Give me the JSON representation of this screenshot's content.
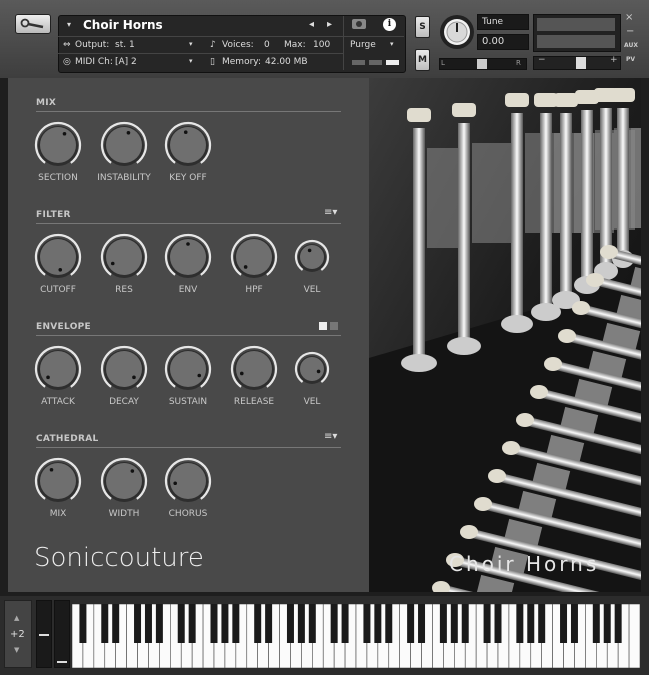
{
  "header": {
    "instrument_name": "Choir Horns",
    "output_label": "Output:",
    "output_value": "st. 1",
    "midi_label": "MIDI Ch:",
    "midi_value": "[A]  2",
    "voices_label": "Voices:",
    "voices_value": "0",
    "max_label": "Max:",
    "max_value": "100",
    "memory_label": "Memory:",
    "memory_value": "42.00 MB",
    "purge_label": "Purge",
    "solo_label": "S",
    "mute_label": "M",
    "tune_label": "Tune",
    "tune_value": "0.00",
    "pan_left": "L",
    "pan_right": "R",
    "aux_label": "AUX",
    "pv_label": "PV"
  },
  "sections": {
    "mix": {
      "title": "MIX",
      "knobs": [
        "SECTION",
        "INSTABILITY",
        "KEY OFF"
      ]
    },
    "filter": {
      "title": "FILTER",
      "knobs": [
        "CUTOFF",
        "RES",
        "ENV",
        "HPF",
        "VEL"
      ]
    },
    "envelope": {
      "title": "ENVELOPE",
      "knobs": [
        "ATTACK",
        "DECAY",
        "SUSTAIN",
        "RELEASE",
        "VEL"
      ]
    },
    "cathedral": {
      "title": "CATHEDRAL",
      "knobs": [
        "MIX",
        "WIDTH",
        "CHORUS"
      ]
    }
  },
  "brand": "Soniccouture",
  "image_caption": "Choir Horns",
  "keyboard": {
    "octave": "+2"
  },
  "colors": {
    "panel": "#494949",
    "knob": "#6f6f6f",
    "ring": "#e6e6e6",
    "header": "#3e3e3e"
  }
}
